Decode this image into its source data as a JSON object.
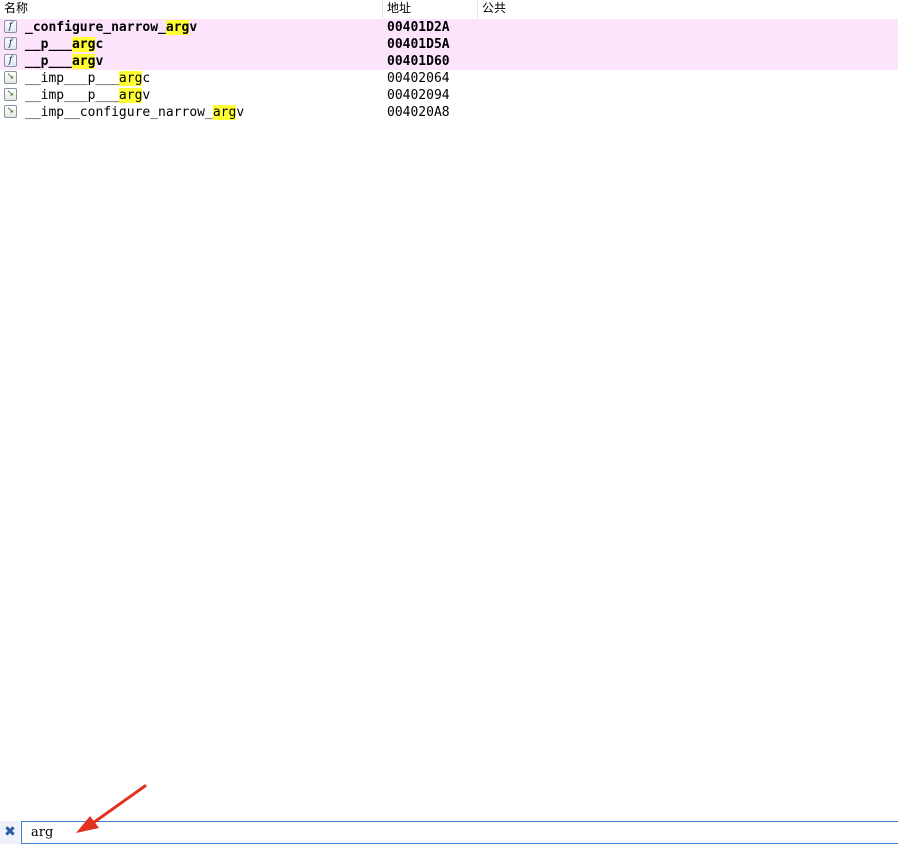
{
  "header": {
    "col_name": "名称",
    "col_address": "地址",
    "col_public": "公共"
  },
  "rows": [
    {
      "kind": "function",
      "icon": "function-icon",
      "prefix": "_configure_narrow_",
      "match": "arg",
      "suffix": "v",
      "address": "00401D2A"
    },
    {
      "kind": "function",
      "icon": "function-icon",
      "prefix": "__p___",
      "match": "arg",
      "suffix": "c",
      "address": "00401D5A"
    },
    {
      "kind": "function",
      "icon": "function-icon",
      "prefix": "__p___",
      "match": "arg",
      "suffix": "v",
      "address": "00401D60"
    },
    {
      "kind": "import",
      "icon": "import-icon",
      "prefix": "__imp___p___",
      "match": "arg",
      "suffix": "c",
      "address": "00402064"
    },
    {
      "kind": "import",
      "icon": "import-icon",
      "prefix": "__imp___p___",
      "match": "arg",
      "suffix": "v",
      "address": "00402094"
    },
    {
      "kind": "import",
      "icon": "import-icon",
      "prefix": "__imp__configure_narrow_",
      "match": "arg",
      "suffix": "v",
      "address": "004020A8"
    }
  ],
  "filter": {
    "value": "arg",
    "clear_icon": "close-icon"
  },
  "colors": {
    "function_row_bg": "#fce4fc",
    "match_highlight": "#ffff33",
    "annotation_arrow": "#e0321e"
  }
}
